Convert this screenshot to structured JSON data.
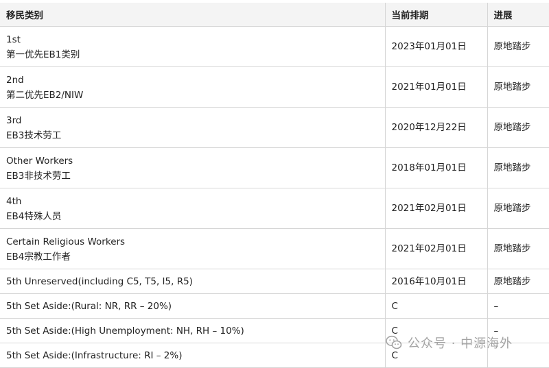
{
  "table": {
    "headers": {
      "category": "移民类别",
      "date": "当前排期",
      "progress": "进展"
    },
    "rows": [
      {
        "line1": "1st",
        "line2": "第一优先EB1类别",
        "date": "2023年01月01日",
        "progress": "原地踏步"
      },
      {
        "line1": "2nd",
        "line2": "第二优先EB2/NIW",
        "date": "2021年01月01日",
        "progress": "原地踏步"
      },
      {
        "line1": "3rd",
        "line2": "EB3技术劳工",
        "date": "2020年12月22日",
        "progress": "原地踏步"
      },
      {
        "line1": "Other Workers",
        "line2": "EB3非技术劳工",
        "date": "2018年01月01日",
        "progress": "原地踏步"
      },
      {
        "line1": "4th",
        "line2": "EB4特殊人员",
        "date": "2021年02月01日",
        "progress": "原地踏步"
      },
      {
        "line1": "Certain Religious Workers",
        "line2": "EB4宗教工作者",
        "date": "2021年02月01日",
        "progress": "原地踏步"
      },
      {
        "line1": "5th Unreserved(including C5, T5, I5, R5)",
        "date": "2016年10月01日",
        "progress": "原地踏步"
      },
      {
        "line1": "5th Set Aside:(Rural: NR, RR – 20%)",
        "date": "C",
        "progress": "–"
      },
      {
        "line1": "5th Set Aside:(High Unemployment: NH, RH – 10%)",
        "date": "C",
        "progress": "–"
      },
      {
        "line1": "5th Set Aside:(Infrastructure: RI – 2%)",
        "date": "C",
        "progress": ""
      }
    ]
  },
  "watermark": {
    "icon": "wechat-icon",
    "text": "公众号 · 中源海外"
  }
}
